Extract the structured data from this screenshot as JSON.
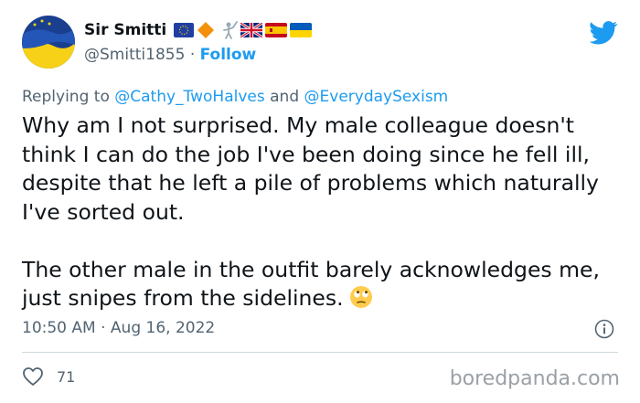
{
  "author": {
    "name": "Sir Smitti",
    "handle": "@Smitti1855",
    "separator": "·",
    "follow_label": "Follow",
    "name_emojis": [
      "eu-flag-icon",
      "orange-diamond-icon",
      "fencer-icon",
      "uk-flag-icon",
      "spain-flag-icon",
      "ukraine-flag-icon"
    ]
  },
  "reply": {
    "prefix": "Replying to",
    "user1": "@Cathy_TwoHalves",
    "conjunction": "and",
    "user2": "@EverydaySexism"
  },
  "tweet": {
    "paragraph1": "Why am I not surprised.  My male colleague doesn't think I can do the job I've been doing since he fell ill, despite that he left a pile of problems which naturally I've sorted out.",
    "paragraph2": "The other male in the outfit barely acknowledges me, just snipes from the sidelines.",
    "emoji": "face-with-rolling-eyes-icon"
  },
  "meta": {
    "time": "10:50 AM",
    "separator": "·",
    "date": "Aug 16, 2022"
  },
  "stats": {
    "likes": "71"
  },
  "watermark": "boredpanda.com",
  "colors": {
    "accent": "#1d9bf0",
    "text": "#0f1419",
    "secondary": "#536471",
    "divider": "#cfd9de"
  }
}
